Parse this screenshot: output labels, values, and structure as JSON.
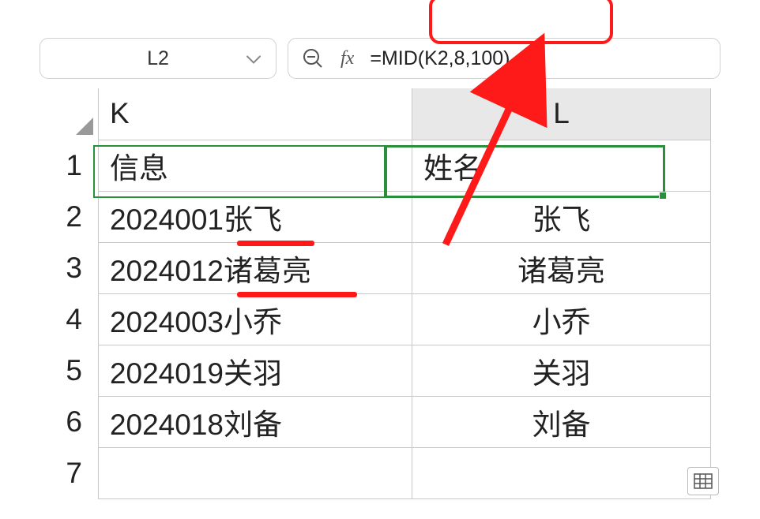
{
  "name_box": {
    "value": "L2"
  },
  "formula_bar": {
    "fx_label": "fx",
    "formula": "=MID(K2,8,100)"
  },
  "columns": {
    "k": "K",
    "l": "L"
  },
  "row_numbers": [
    "1",
    "2",
    "3",
    "4",
    "5",
    "6",
    "7"
  ],
  "rows": [
    {
      "k": "信息",
      "l": "姓名",
      "is_header": true
    },
    {
      "k": "2024001张飞",
      "l": "张飞"
    },
    {
      "k": "2024012诸葛亮",
      "l": "诸葛亮"
    },
    {
      "k": "2024003小乔",
      "l": "小乔"
    },
    {
      "k": "2024019关羽",
      "l": "关羽"
    },
    {
      "k": "2024018刘备",
      "l": "刘备"
    },
    {
      "k": "",
      "l": ""
    }
  ],
  "selection": {
    "cell": "L2"
  },
  "annotations": {
    "highlight_color": "#ff1a1a"
  }
}
